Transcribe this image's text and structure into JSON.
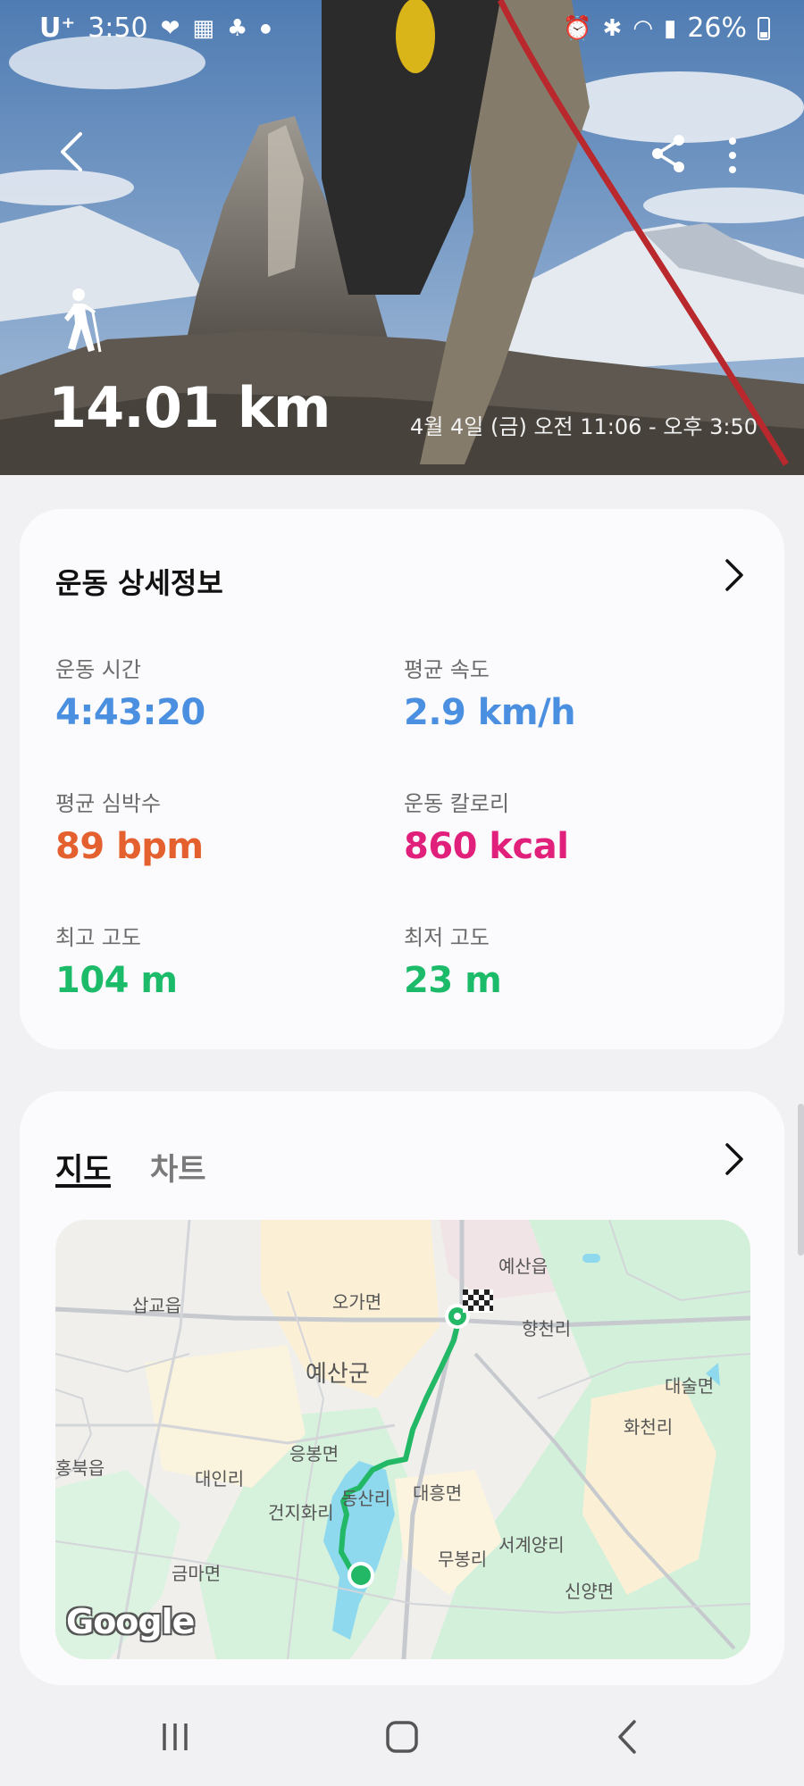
{
  "status_bar": {
    "carrier": "U⁺",
    "time": "3:50",
    "battery": "26%"
  },
  "hero": {
    "activity_icon": "hiking-icon",
    "distance": "14.01 km",
    "date_range": "4월 4일 (금) 오전 11:06 - 오후 3:50"
  },
  "details": {
    "title": "운동 상세정보",
    "metrics": [
      {
        "label": "운동 시간",
        "value": "4:43:20",
        "color": "#4a8fe0"
      },
      {
        "label": "평균 속도",
        "value": "2.9 km/h",
        "color": "#4a8fe0"
      },
      {
        "label": "평균 심박수",
        "value": "89 bpm",
        "color": "#e4602e"
      },
      {
        "label": "운동 칼로리",
        "value": "860 kcal",
        "color": "#e0207a"
      },
      {
        "label": "최고 고도",
        "value": "104 m",
        "color": "#1cbb6a"
      },
      {
        "label": "최저 고도",
        "value": "23 m",
        "color": "#1cbb6a"
      }
    ]
  },
  "map_card": {
    "tabs": [
      "지도",
      "차트"
    ],
    "active_tab": "지도",
    "map_labels": [
      "예산읍",
      "삽교읍",
      "오가면",
      "향천리",
      "예산군",
      "대술면",
      "화천리",
      "홍북읍",
      "응봉면",
      "대인리",
      "동산리",
      "대흥면",
      "건지화리",
      "서계양리",
      "금마면",
      "무봉리",
      "신양면"
    ],
    "attribution": "Google",
    "route_color": "#22b866"
  }
}
